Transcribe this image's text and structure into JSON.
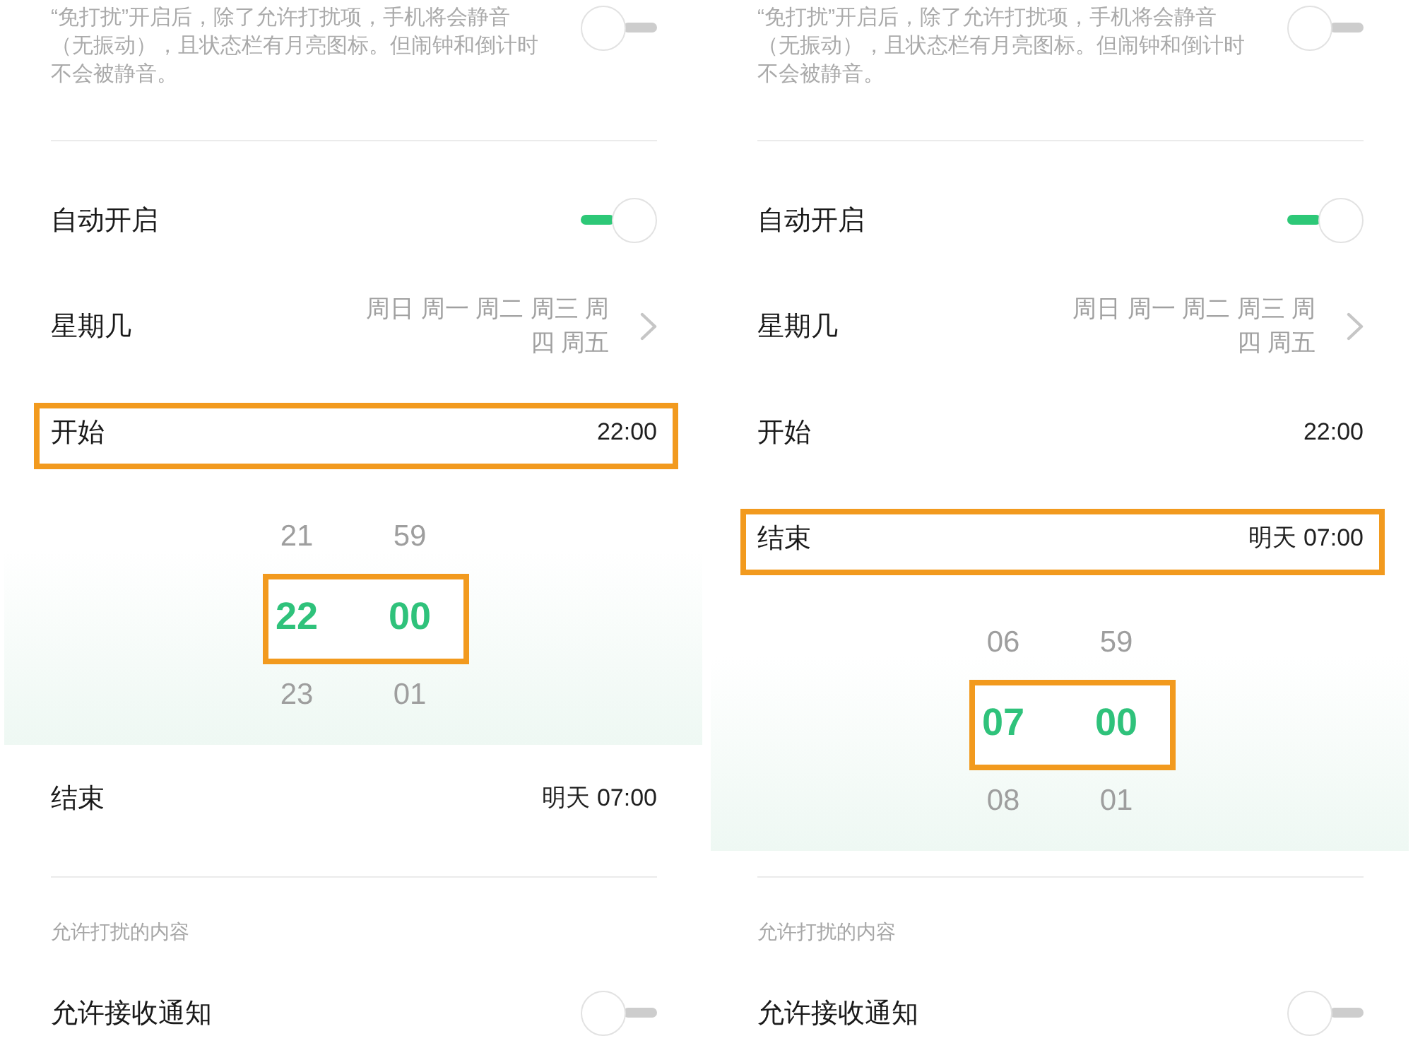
{
  "panels": [
    {
      "items": [
        {
          "kind": "description",
          "text": "“免打扰”开启后，除了允许打扰项，手机将会静音（无振动），且状态栏有月亮图标。但闹钟和倒计时不会被静音。",
          "on": false
        },
        {
          "kind": "divider"
        },
        {
          "kind": "toggle",
          "label": "自动开启",
          "on": true
        },
        {
          "kind": "link",
          "label": "星期几",
          "value": "周日 周一 周二 周三 周四 周五"
        },
        {
          "kind": "time",
          "label": "开始",
          "value": "22:00",
          "highlighted": true
        },
        {
          "kind": "picker",
          "highlighted": true,
          "hours": [
            {
              "text": "21",
              "selected": false
            },
            {
              "text": "22",
              "selected": true
            },
            {
              "text": "23",
              "selected": false
            }
          ],
          "minutes": [
            {
              "text": "59",
              "selected": false
            },
            {
              "text": "00",
              "selected": true
            },
            {
              "text": "01",
              "selected": false
            }
          ]
        },
        {
          "kind": "time",
          "label": "结束",
          "value": "明天 07:00",
          "highlighted": false
        },
        {
          "kind": "divider"
        },
        {
          "kind": "section",
          "label": "允许打扰的内容"
        },
        {
          "kind": "toggle",
          "label": "允许接收通知",
          "on": false
        }
      ]
    },
    {
      "items": [
        {
          "kind": "description",
          "text": "“免打扰”开启后，除了允许打扰项，手机将会静音（无振动），且状态栏有月亮图标。但闹钟和倒计时不会被静音。",
          "on": false
        },
        {
          "kind": "divider"
        },
        {
          "kind": "toggle",
          "label": "自动开启",
          "on": true
        },
        {
          "kind": "link",
          "label": "星期几",
          "value": "周日 周一 周二 周三 周四 周五"
        },
        {
          "kind": "time",
          "label": "开始",
          "value": "22:00",
          "highlighted": false
        },
        {
          "kind": "time",
          "label": "结束",
          "value": "明天 07:00",
          "highlighted": true
        },
        {
          "kind": "picker",
          "highlighted": true,
          "hours": [
            {
              "text": "06",
              "selected": false
            },
            {
              "text": "07",
              "selected": true
            },
            {
              "text": "08",
              "selected": false
            }
          ],
          "minutes": [
            {
              "text": "59",
              "selected": false
            },
            {
              "text": "00",
              "selected": true
            },
            {
              "text": "01",
              "selected": false
            }
          ]
        },
        {
          "kind": "divider"
        },
        {
          "kind": "section",
          "label": "允许打扰的内容"
        },
        {
          "kind": "toggle",
          "label": "允许接收通知",
          "on": false
        }
      ]
    }
  ]
}
